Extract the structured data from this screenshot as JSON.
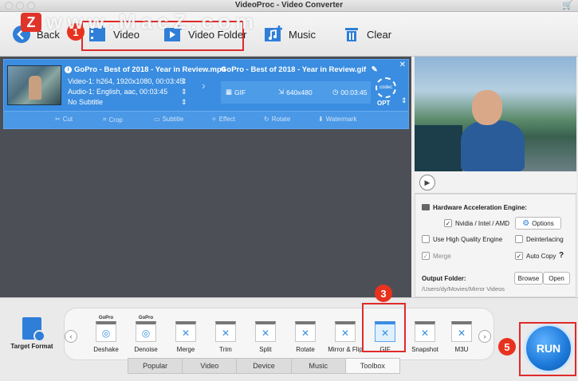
{
  "window": {
    "title": "VideoProc - Video Converter"
  },
  "watermark": {
    "logo_letter": "Z",
    "text": "www.MacZ.com"
  },
  "toolbar": {
    "back_label": "Back",
    "video_label": "Video",
    "video_folder_label": "Video Folder",
    "music_label": "Music",
    "clear_label": "Clear",
    "badge_video_folder": "1"
  },
  "item": {
    "source_title": "GoPro - Best of 2018 - Year in Review.mp4",
    "video_track": "Video-1: h264, 1920x1080, 00:03:45",
    "audio_track": "Audio-1: English, aac, 00:03:45",
    "subtitle": "No Subtitle",
    "output_title": "GoPro - Best of 2018 - Year in Review.gif",
    "output_format": "GIF",
    "output_resolution": "640x480",
    "output_duration": "00:03:45",
    "codec_label": "codec",
    "opt_label": "OPT",
    "edit_tools": [
      "Cut",
      "Crop",
      "Subtitle",
      "Effect",
      "Rotate",
      "Watermark"
    ]
  },
  "settings": {
    "hw_title": "Hardware Acceleration Engine:",
    "nvidia_label": "Nvidia / Intel / AMD",
    "options_label": "Options",
    "high_quality_label": "Use High Quality Engine",
    "deinterlacing_label": "Deinterlacing",
    "merge_label": "Merge",
    "auto_copy_label": "Auto Copy",
    "help_label": "?",
    "output_folder_title": "Output Folder:",
    "output_path": "/Users/dy/Movies/Mirror Videos",
    "browse_label": "Browse",
    "open_label": "Open"
  },
  "bottom": {
    "target_format_label": "Target Format",
    "gopro_tag": "GoPro",
    "tools": [
      "Deshake",
      "Denoise",
      "Merge",
      "Trim",
      "Split",
      "Rotate",
      "Mirror & Flip",
      "GIF",
      "Snapshot",
      "M3U"
    ],
    "tabs": [
      "Popular",
      "Video",
      "Device",
      "Music",
      "Toolbox"
    ],
    "run_label": "RUN",
    "badge_gif": "3",
    "badge_run": "5"
  }
}
